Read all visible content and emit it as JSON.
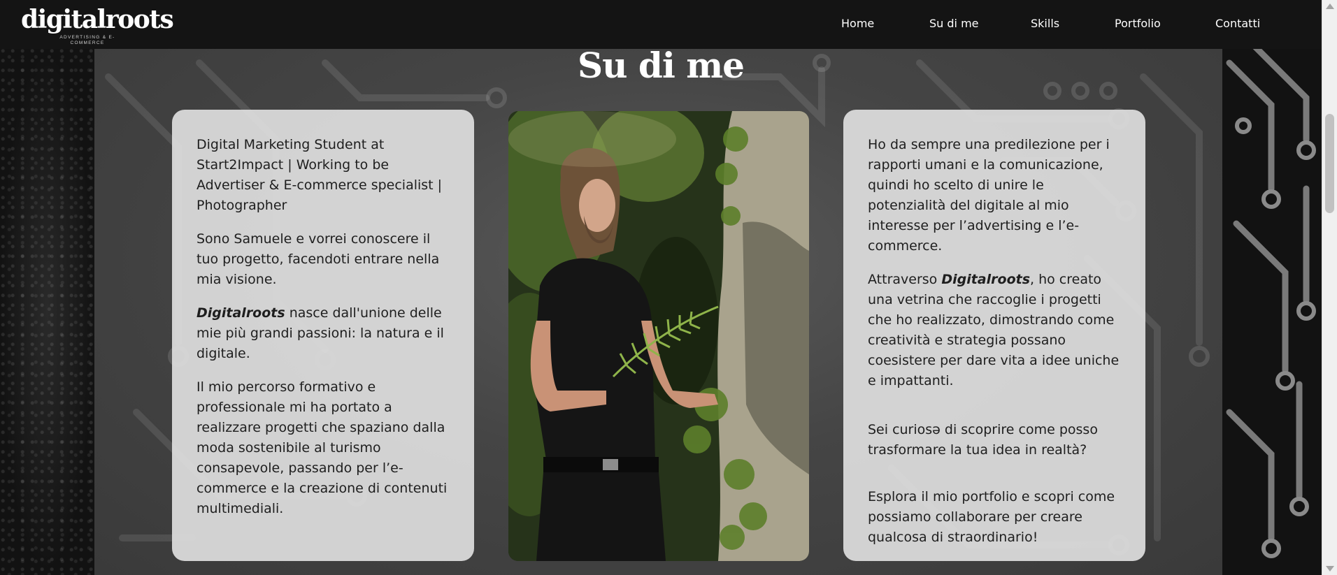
{
  "brand": {
    "logo_text": "digitalroots",
    "logo_tagline": "ADVERTISING & E-COMMERCE"
  },
  "nav": {
    "items": [
      {
        "label": "Home"
      },
      {
        "label": "Su di me"
      },
      {
        "label": "Skills"
      },
      {
        "label": "Portfolio"
      },
      {
        "label": "Contatti"
      }
    ]
  },
  "section": {
    "title": "Su di me"
  },
  "left_card": {
    "p1": "Digital Marketing Student at Start2Impact | Working to be Advertiser & E-commerce specialist | Photographer",
    "p2": "Sono Samuele e vorrei conoscere il tuo progetto, facendoti entrare nella mia visione.",
    "p3_brand": "Digitalroots",
    "p3_rest": " nasce dall'unione delle mie più grandi passioni: la natura e il digitale.",
    "p4": "Il mio percorso formativo e professionale mi ha portato a realizzare progetti che spaziano dalla moda sostenibile al turismo consapevole, passando per l’e-commerce e la creazione di contenuti multimediali."
  },
  "right_card": {
    "p1": "Ho da sempre una predilezione per i rapporti umani e la comunicazione, quindi ho scelto di unire le potenzialità del digitale al mio interesse per l’advertising e l’e-commerce.",
    "p2_start": "Attraverso ",
    "p2_brand": "Digitalroots",
    "p2_rest": ", ho creato una vetrina che raccoglie i progetti che ho realizzato, dimostrando come creatività e strategia possano coesistere per dare vita a idee uniche e impattanti.",
    "p3": "Sei curiosə di scoprire come posso trasformare la tua idea in realtà?",
    "p4": "Esplora il mio portfolio e scopri come possiamo collaborare per creare qualcosa di straordinario!"
  },
  "colors": {
    "header_bg": "#141414",
    "card_bg": "#dedede",
    "title_color": "#ffffff"
  }
}
